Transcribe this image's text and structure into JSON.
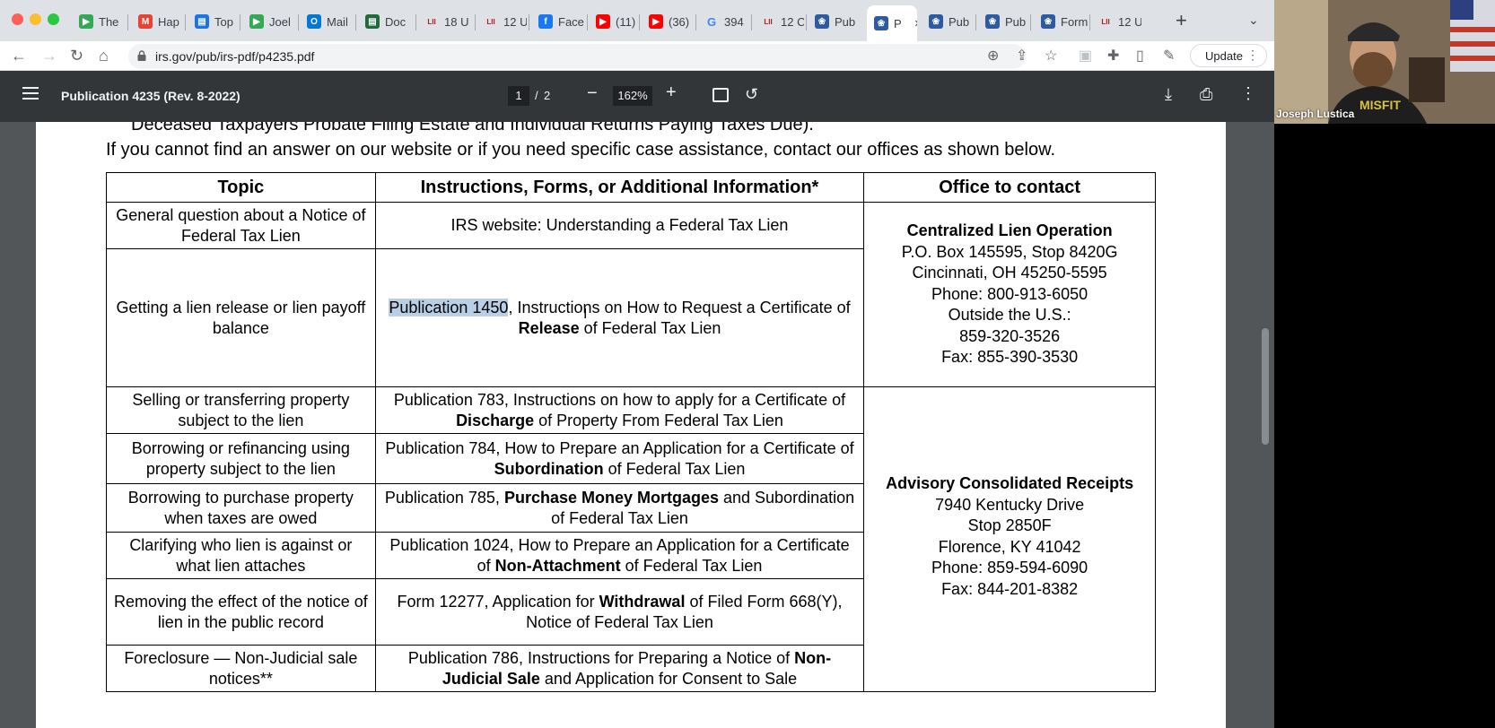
{
  "browser": {
    "tabs": [
      {
        "title": "The",
        "icon": "play-icon",
        "color": "#34a853"
      },
      {
        "title": "Hap",
        "icon": "gmail-icon",
        "color": "#ea4335"
      },
      {
        "title": "Top",
        "icon": "doc-icon",
        "color": "#1a73e8"
      },
      {
        "title": "Joel",
        "icon": "play-icon",
        "color": "#34a853"
      },
      {
        "title": "Mail",
        "icon": "outlook-icon",
        "color": "#0078d4"
      },
      {
        "title": "Doc",
        "icon": "doc-icon",
        "color": "#1e6b3a"
      },
      {
        "title": "18 U",
        "icon": "lii-icon",
        "color": "#b31b1b"
      },
      {
        "title": "12 U",
        "icon": "lii-icon",
        "color": "#b31b1b"
      },
      {
        "title": "Face",
        "icon": "facebook-icon",
        "color": "#1877f2"
      },
      {
        "title": "(11)",
        "icon": "youtube-icon",
        "color": "#ff0000"
      },
      {
        "title": "(36)",
        "icon": "youtube-icon",
        "color": "#ff0000"
      },
      {
        "title": "394",
        "icon": "google-icon",
        "color": "#4285f4"
      },
      {
        "title": "12 C",
        "icon": "lii-icon",
        "color": "#b31b1b"
      },
      {
        "title": "Pub",
        "icon": "irs-icon",
        "color": "#2d5aa0"
      },
      {
        "title": "P",
        "icon": "irs-icon",
        "color": "#2d5aa0",
        "active": true
      },
      {
        "title": "Pub",
        "icon": "irs-icon",
        "color": "#2d5aa0"
      },
      {
        "title": "Pub",
        "icon": "irs-icon",
        "color": "#2d5aa0"
      },
      {
        "title": "Form",
        "icon": "irs-icon",
        "color": "#2d5aa0"
      },
      {
        "title": "12 U",
        "icon": "lii-icon",
        "color": "#b31b1b"
      }
    ],
    "url": "irs.gov/pub/irs-pdf/p4235.pdf",
    "update_label": "Update"
  },
  "pdf": {
    "title": "Publication 4235 (Rev. 8-2022)",
    "page_current": "1",
    "page_sep": "/",
    "page_total": "2",
    "zoom": "162%"
  },
  "doc": {
    "cut_line": "Deceased Taxpayers Probate Filing Estate and Individual Returns Paying Taxes Due).",
    "intro": "If you cannot find an answer on our website or if you need specific case assistance, contact our offices as shown below.",
    "headers": {
      "topic": "Topic",
      "instructions": "Instructions, Forms, or Additional Information*",
      "office": "Office to contact"
    },
    "rows": [
      {
        "topic": "General question about a Notice of Federal Tax Lien",
        "instr_pre": "IRS website: Understanding a Federal Tax Lien",
        "instr_bold": "",
        "instr_post": ""
      },
      {
        "topic": "Getting a lien release or lien payoff balance",
        "instr_hl": "Publication 1450",
        "instr_pre": ", Instructions on How to Request a Certificate of ",
        "instr_bold": "Release",
        "instr_post": " of Federal Tax Lien"
      },
      {
        "topic": "Selling or transferring property subject to the lien",
        "instr_pre": "Publication 783, Instructions on how to apply for a Certificate of ",
        "instr_bold": "Discharge",
        "instr_post": " of Property From Federal Tax Lien"
      },
      {
        "topic": "Borrowing or refinancing using property subject to the lien",
        "instr_pre": "Publication 784, How to Prepare an Application for a Certificate of ",
        "instr_bold": "Subordination",
        "instr_post": " of Federal Tax Lien"
      },
      {
        "topic": "Borrowing to purchase property when taxes are owed",
        "instr_pre": "Publication 785, ",
        "instr_bold": "Purchase Money Mortgages",
        "instr_post": " and Subordination of Federal Tax Lien"
      },
      {
        "topic": "Clarifying who lien is against or what lien attaches",
        "instr_pre": "Publication 1024, How to Prepare an Application for a Certificate of ",
        "instr_bold": "Non-Attachment",
        "instr_post": " of Federal Tax Lien"
      },
      {
        "topic": "Removing the effect of the notice of lien in the public record",
        "instr_pre": "Form 12277, Application for ",
        "instr_bold": "Withdrawal",
        "instr_post": " of Filed Form 668(Y), Notice of Federal Tax Lien"
      },
      {
        "topic": "Foreclosure — Non-Judicial sale notices**",
        "instr_pre": "Publication 786, Instructions for Preparing a Notice of ",
        "instr_bold": "Non-Judicial Sale",
        "instr_post": " and Application for Consent to Sale"
      }
    ],
    "offices": [
      {
        "name": "Centralized Lien Operation",
        "lines": [
          "P.O. Box 145595, Stop 8420G",
          "Cincinnati, OH 45250-5595",
          "Phone: 800-913-6050",
          "Outside the U.S.:",
          "859-320-3526",
          "Fax: 855-390-3530"
        ]
      },
      {
        "name": "Advisory Consolidated Receipts",
        "lines": [
          "7940 Kentucky Drive",
          "Stop 2850F",
          "Florence, KY 41042",
          "Phone: 859-594-6090",
          "Fax: 844-201-8382"
        ]
      }
    ]
  },
  "webcam": {
    "name": "Joseph Lustica"
  }
}
